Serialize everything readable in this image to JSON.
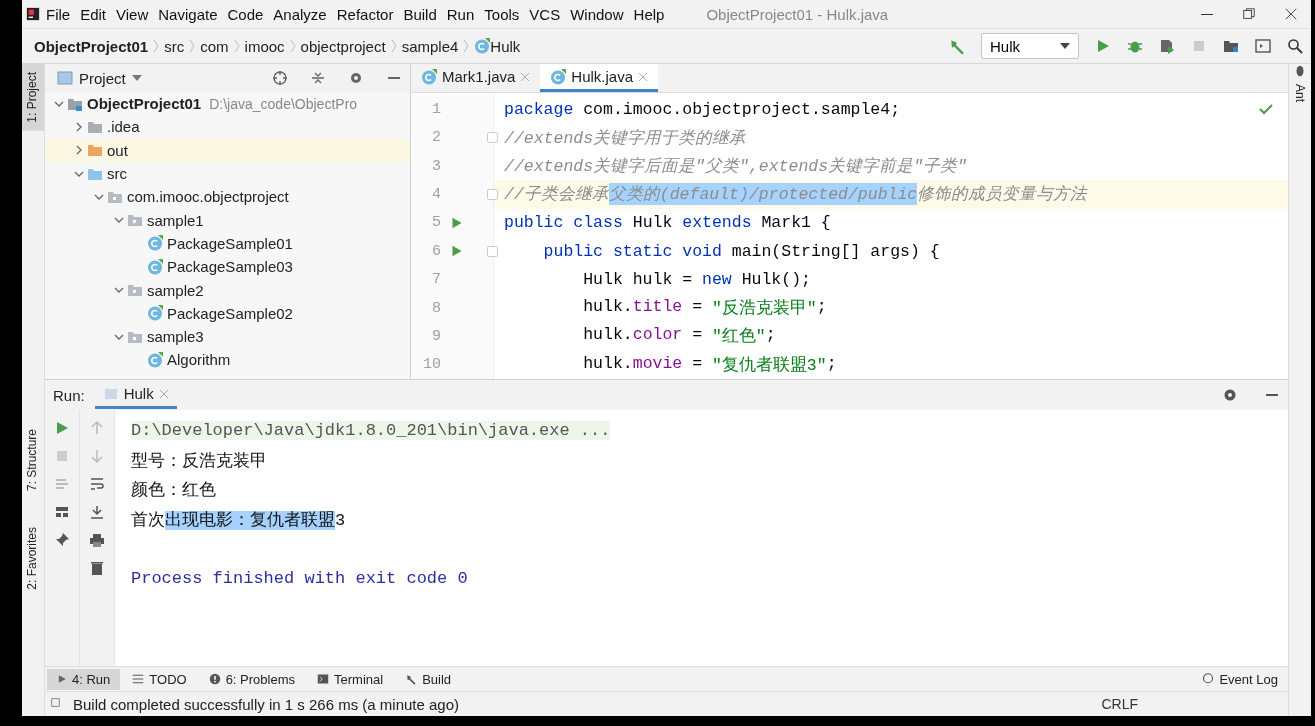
{
  "menu": [
    "File",
    "Edit",
    "View",
    "Navigate",
    "Code",
    "Analyze",
    "Refactor",
    "Build",
    "Run",
    "Tools",
    "VCS",
    "Window",
    "Help"
  ],
  "window": {
    "title": "ObjectProject01 - Hulk.java"
  },
  "breadcrumbs": [
    {
      "label": "ObjectProject01",
      "kind": "project"
    },
    {
      "label": "src",
      "kind": "dir"
    },
    {
      "label": "com",
      "kind": "dir"
    },
    {
      "label": "imooc",
      "kind": "dir"
    },
    {
      "label": "objectproject",
      "kind": "dir"
    },
    {
      "label": "sample4",
      "kind": "dir"
    },
    {
      "label": "Hulk",
      "kind": "class"
    }
  ],
  "run_config": {
    "label": "Hulk"
  },
  "left_tool_tabs": [
    {
      "label": "1: Project",
      "selected": true
    },
    {
      "label": "7: Structure",
      "selected": false
    },
    {
      "label": "2: Favorites",
      "selected": false
    }
  ],
  "right_tool_tabs": [
    {
      "label": "Ant"
    }
  ],
  "project_panel": {
    "title": "Project",
    "tree": [
      {
        "label": "ObjectProject01",
        "path": "D:\\java_code\\ObjectPro",
        "kind": "module",
        "expanded": true,
        "highlighted": false,
        "children": [
          {
            "label": ".idea",
            "kind": "folder",
            "expanded": false,
            "highlighted": false
          },
          {
            "label": "out",
            "kind": "folder-excluded",
            "expanded": false,
            "highlighted": true
          },
          {
            "label": "src",
            "kind": "folder-source",
            "expanded": true,
            "highlighted": false,
            "children": [
              {
                "label": "com.imooc.objectproject",
                "kind": "package",
                "expanded": true,
                "highlighted": false,
                "children": [
                  {
                    "label": "sample1",
                    "kind": "package",
                    "expanded": true,
                    "highlighted": false,
                    "children": [
                      {
                        "label": "PackageSample01",
                        "kind": "class",
                        "highlighted": false
                      },
                      {
                        "label": "PackageSample03",
                        "kind": "class",
                        "highlighted": false
                      }
                    ]
                  },
                  {
                    "label": "sample2",
                    "kind": "package",
                    "expanded": true,
                    "highlighted": false,
                    "children": [
                      {
                        "label": "PackageSample02",
                        "kind": "class",
                        "highlighted": false
                      }
                    ]
                  },
                  {
                    "label": "sample3",
                    "kind": "package",
                    "expanded": true,
                    "highlighted": false,
                    "children": [
                      {
                        "label": "Algorithm",
                        "kind": "class",
                        "highlighted": false
                      }
                    ]
                  }
                ]
              }
            ]
          }
        ]
      }
    ]
  },
  "editor": {
    "tabs": [
      {
        "label": "Mark1.java",
        "selected": false
      },
      {
        "label": "Hulk.java",
        "selected": true
      }
    ],
    "lines": [
      {
        "number": "1",
        "run": false,
        "fold": false,
        "current": false,
        "tokens": [
          {
            "kind": "keyword",
            "text": "package",
            "selected": false
          },
          {
            "kind": "plain",
            "text": " com.imooc.objectproject.sample4;",
            "selected": false
          }
        ]
      },
      {
        "number": "2",
        "run": false,
        "fold": true,
        "current": false,
        "tokens": [
          {
            "kind": "comment",
            "text": "//extends关键字用于类的继承",
            "selected": false
          }
        ]
      },
      {
        "number": "3",
        "run": false,
        "fold": false,
        "current": false,
        "tokens": [
          {
            "kind": "comment",
            "text": "//extends关键字后面是\"父类\",extends关键字前是\"子类\"",
            "selected": false
          }
        ]
      },
      {
        "number": "4",
        "run": false,
        "fold": true,
        "current": true,
        "tokens": [
          {
            "kind": "comment",
            "text": "//子类会继承",
            "selected": false
          },
          {
            "kind": "comment",
            "text": "父类的(default)/protected/public",
            "selected": true
          },
          {
            "kind": "comment",
            "text": "修饰的成员变量与方法",
            "selected": false
          }
        ]
      },
      {
        "number": "5",
        "run": true,
        "fold": false,
        "current": false,
        "tokens": [
          {
            "kind": "keyword",
            "text": "public class",
            "selected": false
          },
          {
            "kind": "plain",
            "text": " Hulk ",
            "selected": false
          },
          {
            "kind": "keyword",
            "text": "extends",
            "selected": false
          },
          {
            "kind": "plain",
            "text": " Mark1 {",
            "selected": false
          }
        ]
      },
      {
        "number": "6",
        "run": true,
        "fold": true,
        "current": false,
        "tokens": [
          {
            "kind": "keyword",
            "text": "    public static void",
            "selected": false
          },
          {
            "kind": "plain",
            "text": " main(String[] args) {",
            "selected": false
          }
        ]
      },
      {
        "number": "7",
        "run": false,
        "fold": false,
        "current": false,
        "tokens": [
          {
            "kind": "plain",
            "text": "        Hulk hulk = ",
            "selected": false
          },
          {
            "kind": "keyword",
            "text": "new",
            "selected": false
          },
          {
            "kind": "plain",
            "text": " Hulk();",
            "selected": false
          }
        ]
      },
      {
        "number": "8",
        "run": false,
        "fold": false,
        "current": false,
        "tokens": [
          {
            "kind": "plain",
            "text": "        hulk.",
            "selected": false
          },
          {
            "kind": "field",
            "text": "title",
            "selected": false
          },
          {
            "kind": "plain",
            "text": " = ",
            "selected": false
          },
          {
            "kind": "string",
            "text": "\"反浩克装甲\"",
            "selected": false
          },
          {
            "kind": "plain",
            "text": ";",
            "selected": false
          }
        ]
      },
      {
        "number": "9",
        "run": false,
        "fold": false,
        "current": false,
        "tokens": [
          {
            "kind": "plain",
            "text": "        hulk.",
            "selected": false
          },
          {
            "kind": "field",
            "text": "color",
            "selected": false
          },
          {
            "kind": "plain",
            "text": " = ",
            "selected": false
          },
          {
            "kind": "string",
            "text": "\"红色\"",
            "selected": false
          },
          {
            "kind": "plain",
            "text": ";",
            "selected": false
          }
        ]
      },
      {
        "number": "10",
        "run": false,
        "fold": false,
        "current": false,
        "tokens": [
          {
            "kind": "plain",
            "text": "        hulk.",
            "selected": false
          },
          {
            "kind": "field",
            "text": "movie",
            "selected": false
          },
          {
            "kind": "plain",
            "text": " = ",
            "selected": false
          },
          {
            "kind": "string",
            "text": "\"复仇者联盟3\"",
            "selected": false
          },
          {
            "kind": "plain",
            "text": ";",
            "selected": false
          }
        ]
      }
    ]
  },
  "run_panel": {
    "label": "Run:",
    "tabs": [
      {
        "label": "Hulk",
        "selected": true
      }
    ],
    "output": [
      {
        "kind": "command",
        "segments": [
          {
            "text": "D:\\Developer\\Java\\jdk1.8.0_201\\bin\\java.exe ...",
            "selected": false
          }
        ]
      },
      {
        "kind": "stdout",
        "segments": [
          {
            "text": "型号：反浩克装甲",
            "selected": false
          }
        ]
      },
      {
        "kind": "stdout",
        "segments": [
          {
            "text": "颜色：红色",
            "selected": false
          }
        ]
      },
      {
        "kind": "stdout",
        "segments": [
          {
            "text": "首次",
            "selected": false
          },
          {
            "text": "出现电影：复仇者联盟",
            "selected": true
          },
          {
            "text": "3",
            "selected": false
          }
        ]
      },
      {
        "kind": "blank"
      },
      {
        "kind": "system",
        "segments": [
          {
            "text": "Process finished with exit code 0",
            "selected": false
          }
        ]
      }
    ]
  },
  "bottom_tool_tabs": [
    {
      "label": "4: Run",
      "kind": "run",
      "selected": true
    },
    {
      "label": "TODO",
      "kind": "todo",
      "selected": false
    },
    {
      "label": "6: Problems",
      "kind": "problems",
      "selected": false
    },
    {
      "label": "Terminal",
      "kind": "terminal",
      "selected": false
    },
    {
      "label": "Build",
      "kind": "build",
      "selected": false
    }
  ],
  "event_log": {
    "label": "Event Log"
  },
  "status_bar": {
    "message": "Build completed successfully in 1 s 266 ms (a minute ago)",
    "items": [
      "CRLF"
    ]
  }
}
